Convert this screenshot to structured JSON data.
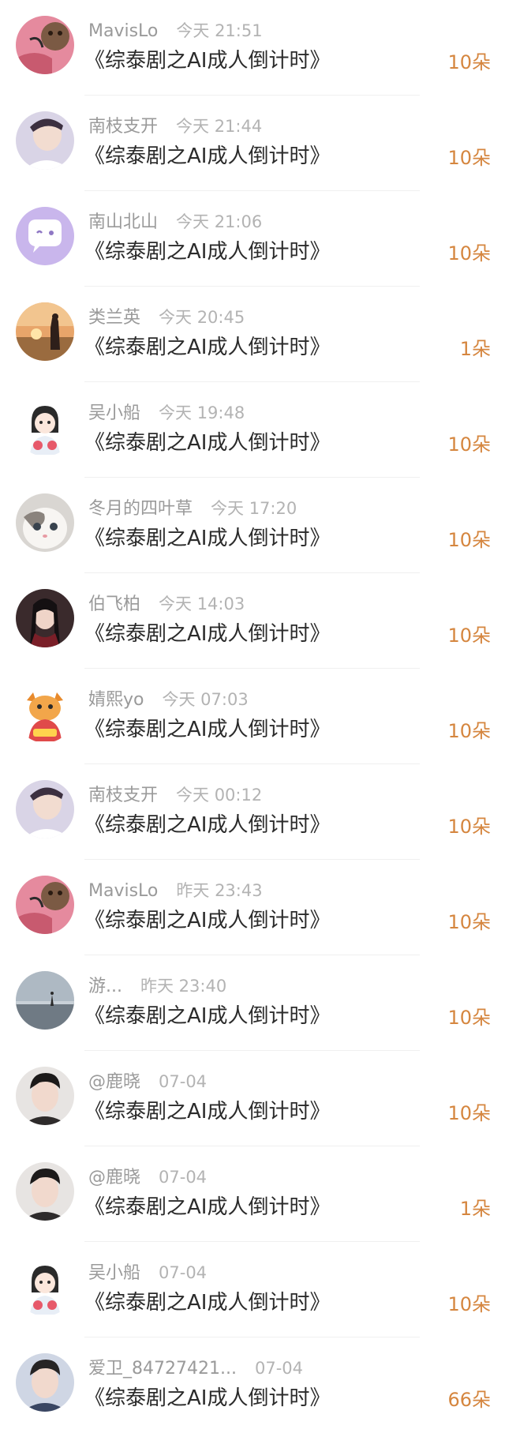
{
  "gift_list": {
    "items": [
      {
        "user": "MavisLo",
        "time": "今天 21:51",
        "title": "《综泰剧之AI成人倒计时》",
        "amount": "10朵",
        "avatar": "cat-pink-avatar"
      },
      {
        "user": "南枝支开",
        "time": "今天 21:44",
        "title": "《综泰剧之AI成人倒计时》",
        "amount": "10朵",
        "avatar": "young-man-avatar"
      },
      {
        "user": "南山北山",
        "time": "今天 21:06",
        "title": "《综泰剧之AI成人倒计时》",
        "amount": "10朵",
        "avatar": "chat-bubble-avatar"
      },
      {
        "user": "类兰英",
        "time": "今天 20:45",
        "title": "《综泰剧之AI成人倒计时》",
        "amount": "1朵",
        "avatar": "sunset-couple-avatar"
      },
      {
        "user": "吴小船",
        "time": "今天 19:48",
        "title": "《综泰剧之AI成人倒计时》",
        "amount": "10朵",
        "avatar": "cartoon-girl-avatar"
      },
      {
        "user": "冬月的四叶草",
        "time": "今天 17:20",
        "title": "《综泰剧之AI成人倒计时》",
        "amount": "10朵",
        "avatar": "white-cat-avatar"
      },
      {
        "user": "伯飞柏",
        "time": "今天 14:03",
        "title": "《综泰剧之AI成人倒计时》",
        "amount": "10朵",
        "avatar": "anime-man-avatar"
      },
      {
        "user": "婧熙yo",
        "time": "今天 07:03",
        "title": "《综泰剧之AI成人倒计时》",
        "amount": "10朵",
        "avatar": "dragon-mascot-avatar"
      },
      {
        "user": "南枝支开",
        "time": "今天 00:12",
        "title": "《综泰剧之AI成人倒计时》",
        "amount": "10朵",
        "avatar": "young-man-avatar"
      },
      {
        "user": "MavisLo",
        "time": "昨天 23:43",
        "title": "《综泰剧之AI成人倒计时》",
        "amount": "10朵",
        "avatar": "cat-pink-avatar"
      },
      {
        "user": "游...",
        "time": "昨天 23:40",
        "title": "《综泰剧之AI成人倒计时》",
        "amount": "10朵",
        "avatar": "beach-avatar"
      },
      {
        "user": "@鹿晓",
        "time": "07-04",
        "title": "《综泰剧之AI成人倒计时》",
        "amount": "10朵",
        "avatar": "portrait-man-avatar"
      },
      {
        "user": "@鹿晓",
        "time": "07-04",
        "title": "《综泰剧之AI成人倒计时》",
        "amount": "1朵",
        "avatar": "portrait-man-avatar"
      },
      {
        "user": "吴小船",
        "time": "07-04",
        "title": "《综泰剧之AI成人倒计时》",
        "amount": "10朵",
        "avatar": "cartoon-girl-avatar"
      },
      {
        "user": "爱卫_84727421...",
        "time": "07-04",
        "title": "《综泰剧之AI成人倒计时》",
        "amount": "66朵",
        "avatar": "portrait-man-avatar"
      }
    ]
  }
}
